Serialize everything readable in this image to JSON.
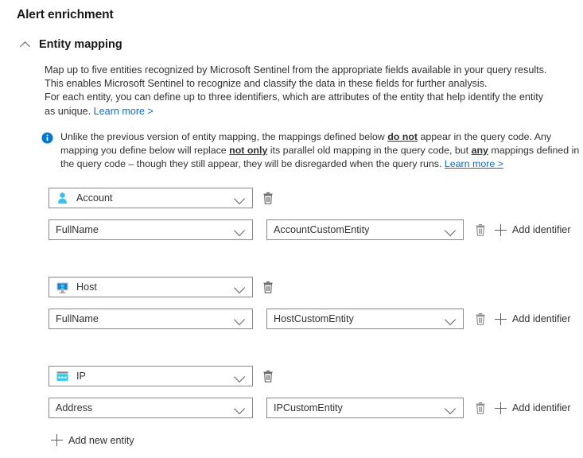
{
  "page": {
    "title": "Alert enrichment"
  },
  "section": {
    "title": "Entity mapping",
    "expanded_icon": "chevron-up-icon",
    "description": {
      "line1": "Map up to five entities recognized by Microsoft Sentinel from the appropriate fields available in your query results.",
      "line2": "This enables Microsoft Sentinel to recognize and classify the data in these fields for further analysis.",
      "line3": "For each entity, you can define up to three identifiers, which are attributes of the entity that help identify the entity",
      "line4_prefix": "as unique.",
      "learn_more": "Learn more >"
    }
  },
  "info": {
    "icon": "info-circle-icon",
    "p1": "Unlike the previous version of entity mapping, the mappings defined below ",
    "b1": "do not",
    "p2": " appear in the query code. Any mapping you define below will replace ",
    "b2": "not only",
    "p3": " its parallel old mapping in the query code, but ",
    "b3": "any",
    "p4": " mappings defined in the query code – though they still appear, they will be disregarded when the query runs. ",
    "learn_more": "Learn more >"
  },
  "entities": [
    {
      "icon": "account-user-icon",
      "name": "Account",
      "delete_label": "trash-icon",
      "identifiers": [
        {
          "identifier": "FullName",
          "field": "AccountCustomEntity",
          "add_label": "Add identifier"
        }
      ]
    },
    {
      "icon": "host-monitor-icon",
      "name": "Host",
      "delete_label": "trash-icon",
      "identifiers": [
        {
          "identifier": "FullName",
          "field": "HostCustomEntity",
          "add_label": "Add identifier"
        }
      ]
    },
    {
      "icon": "ip-address-icon",
      "name": "IP",
      "delete_label": "trash-icon",
      "identifiers": [
        {
          "identifier": "Address",
          "field": "IPCustomEntity",
          "add_label": "Add identifier"
        }
      ]
    }
  ],
  "footer": {
    "add_new_entity": "Add new entity"
  },
  "colors": {
    "link": "#0f6cbd",
    "info_blue": "#0078d4",
    "account_icon": "#34c3f0",
    "host_icon": "#0f86d8",
    "ip_icon": "#32c8ea",
    "border": "#8a8886",
    "text": "#323130"
  }
}
